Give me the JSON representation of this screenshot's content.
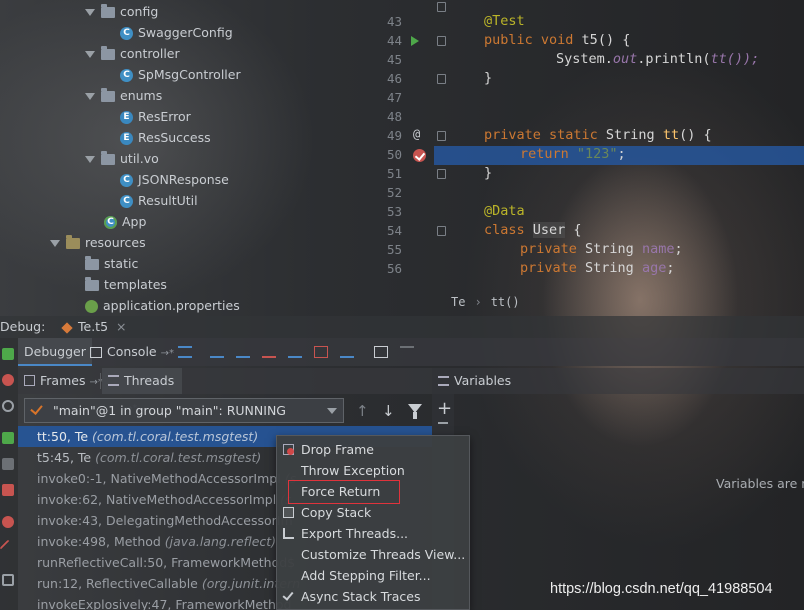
{
  "project_tree": [
    {
      "label": "config",
      "kind": "folder"
    },
    {
      "label": "SwaggerConfig",
      "kind": "class"
    },
    {
      "label": "controller",
      "kind": "folder"
    },
    {
      "label": "SpMsgController",
      "kind": "class"
    },
    {
      "label": "enums",
      "kind": "folder"
    },
    {
      "label": "ResError",
      "kind": "enum"
    },
    {
      "label": "ResSuccess",
      "kind": "enum"
    },
    {
      "label": "util.vo",
      "kind": "folder"
    },
    {
      "label": "JSONResponse",
      "kind": "class"
    },
    {
      "label": "ResultUtil",
      "kind": "class"
    },
    {
      "label": "App",
      "kind": "app"
    },
    {
      "label": "resources",
      "kind": "folder-resource"
    },
    {
      "label": "static",
      "kind": "folder"
    },
    {
      "label": "templates",
      "kind": "folder"
    },
    {
      "label": "application.properties",
      "kind": "file"
    }
  ],
  "editor": {
    "line_numbers": [
      "43",
      "44",
      "45",
      "46",
      "47",
      "48",
      "49",
      "50",
      "51",
      "52",
      "53",
      "54",
      "55",
      "56"
    ],
    "current_line": "50",
    "breadcrumb": [
      "Te",
      "tt()"
    ],
    "code": {
      "l43_ann": "@Test",
      "l44_kw": "public void ",
      "l44_fn": "t5",
      "l44_rest": "() {",
      "l45_a": "System.",
      "l45_out": "out",
      "l45_b": ".println(",
      "l45_c": "tt());",
      "l46": "}",
      "l49_kw": "private static ",
      "l49_type": "String ",
      "l49_fn": "tt",
      "l49_rest": "() {",
      "l50_kw": "return ",
      "l50_str": "\"123\"",
      "l50_rest": ";",
      "l51": "}",
      "l53_ann": "@Data",
      "l54_kw": "class ",
      "l54_name": "User",
      "l54_rest": " {",
      "l55_kw": "private ",
      "l55_type": "String ",
      "l55_fld": "name",
      "l55_rest": ";",
      "l56_kw": "private ",
      "l56_type": "String ",
      "l56_fld": "age",
      "l56_rest": ";"
    }
  },
  "debug": {
    "title": "Debug:",
    "session_tab": "Te.t5",
    "close": "×",
    "tabs": {
      "debugger": "Debugger",
      "console": "Console",
      "console_suffix": "→*"
    },
    "frames_tab": "Frames",
    "frames_suffix": "→*",
    "threads_tab": "Threads",
    "threads_suffix": "→*",
    "variables_tab": "Variables",
    "thread_selector": "\"main\"@1 in group \"main\": RUNNING",
    "variables_empty": "Variables are n",
    "frames": [
      {
        "method": "tt:50, Te ",
        "pkg": "(com.tl.coral.test.msgtest)"
      },
      {
        "method": "t5:45, Te ",
        "pkg": "(com.tl.coral.test.msgtest)"
      },
      {
        "method": "invoke0:-1, NativeMethodAccessorImpl ",
        "pkg": "(s"
      },
      {
        "method": "invoke:62, NativeMethodAccessorImpl ",
        "pkg": "(s"
      },
      {
        "method": "invoke:43, DelegatingMethodAccessorIm",
        "pkg": ""
      },
      {
        "method": "invoke:498, Method ",
        "pkg": "(java.lang.reflect)"
      },
      {
        "method": "runReflectiveCall:50, FrameworkMethod$",
        "pkg": ""
      },
      {
        "method": "run:12, ReflectiveCallable ",
        "pkg": "(org.junit.intern"
      },
      {
        "method": "invokeExplosively:47, FrameworkMethod",
        "pkg": ""
      }
    ]
  },
  "context_menu": [
    {
      "label": "Drop Frame",
      "icon": "drop-frame-icon"
    },
    {
      "label": "Throw Exception",
      "icon": ""
    },
    {
      "label": "Force Return",
      "icon": ""
    },
    {
      "label": "Copy Stack",
      "icon": "copy-icon"
    },
    {
      "label": "Export Threads...",
      "icon": "export-icon"
    },
    {
      "label": "Customize Threads View...",
      "icon": ""
    },
    {
      "label": "Add Stepping Filter...",
      "icon": ""
    },
    {
      "label": "Async Stack Traces",
      "icon": "check-icon"
    }
  ],
  "watermark": "https://blog.csdn.net/qq_41988504",
  "colors": {
    "selection": "#26569b",
    "highlight_box": "#e0333c",
    "breakpoint": "#c75450",
    "run": "#4ea84a"
  }
}
